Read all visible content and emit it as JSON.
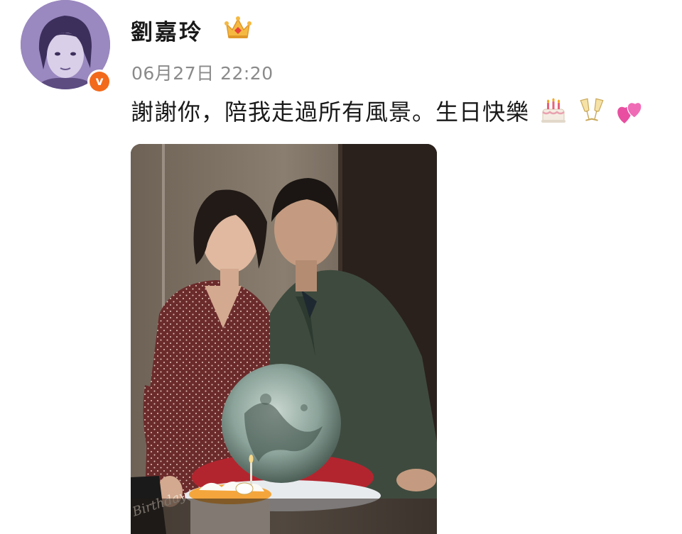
{
  "author": {
    "name": "劉嘉玲",
    "verified_badge_text": "v",
    "vip_icon": "crown-icon"
  },
  "post": {
    "timestamp": "06月27日 22:20",
    "text": "謝謝你，陪我走過所有風景。生日快樂",
    "emojis": [
      "birthday-cake-icon",
      "clinking-glasses-icon",
      "two-hearts-icon"
    ]
  },
  "photo": {
    "cake_sign": "Birthday"
  },
  "colors": {
    "badge_orange": "#f26a1b",
    "timestamp_gray": "#8a8a8a",
    "avatar_purple": "#8f7db3"
  }
}
